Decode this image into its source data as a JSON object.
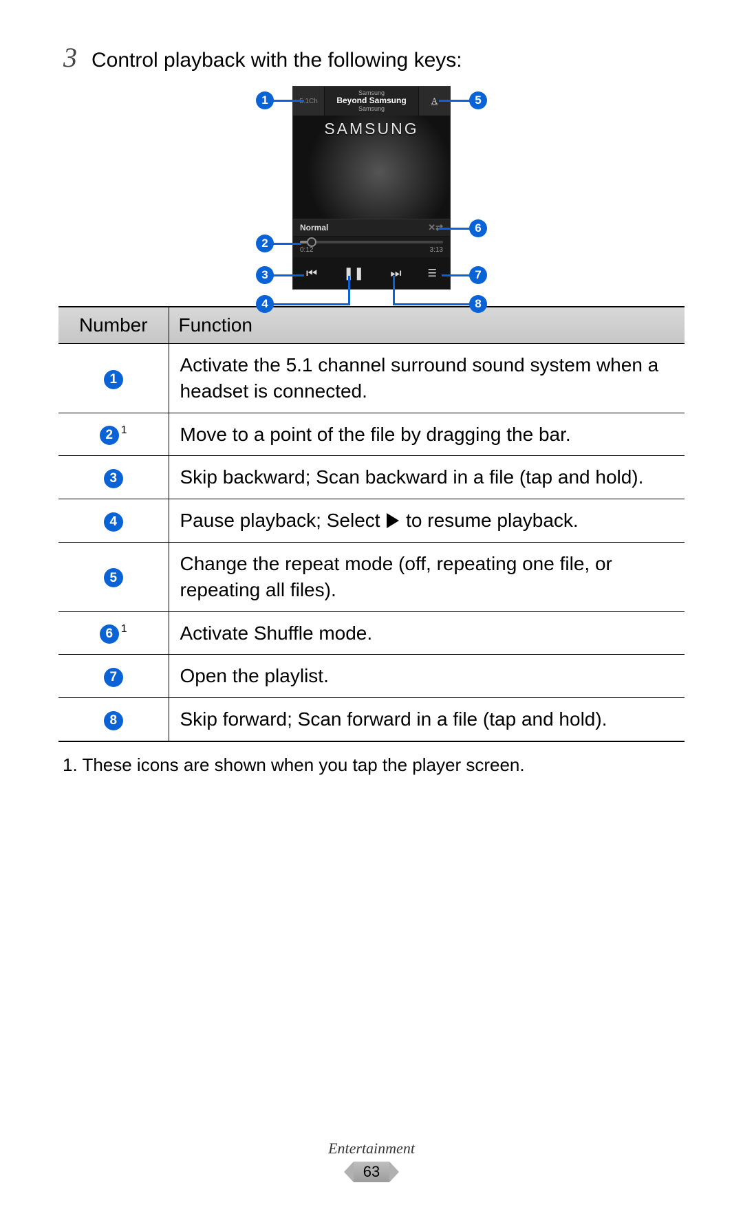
{
  "step": {
    "number": "3",
    "text": "Control playback with the following keys:"
  },
  "player": {
    "surround_label": "5.1Ch",
    "artist_top": "Samsung",
    "track_title": "Beyond Samsung",
    "artist_bottom": "Samsung",
    "album_logo": "SAMSUNG",
    "repeat_label": "A",
    "eq_label": "Normal",
    "time_elapsed": "0:12",
    "time_total": "3:13"
  },
  "callouts": {
    "c1": "1",
    "c2": "2",
    "c3": "3",
    "c4": "4",
    "c5": "5",
    "c6": "6",
    "c7": "7",
    "c8": "8"
  },
  "table": {
    "head_number": "Number",
    "head_function": "Function",
    "rows": [
      {
        "num": "1",
        "sup": "",
        "func": "Activate the 5.1 channel surround sound system when a headset is connected."
      },
      {
        "num": "2",
        "sup": "1",
        "func": "Move to a point of the file by dragging the bar."
      },
      {
        "num": "3",
        "sup": "",
        "func": "Skip backward; Scan backward in a file (tap and hold)."
      },
      {
        "num": "4",
        "sup": "",
        "func_pre": "Pause playback; Select ",
        "func_post": " to resume playback."
      },
      {
        "num": "5",
        "sup": "",
        "func": "Change the repeat mode (off, repeating one file, or repeating all files)."
      },
      {
        "num": "6",
        "sup": "1",
        "func": "Activate Shuffle mode."
      },
      {
        "num": "7",
        "sup": "",
        "func": "Open the playlist."
      },
      {
        "num": "8",
        "sup": "",
        "func": "Skip forward; Scan forward in a file (tap and hold)."
      }
    ]
  },
  "footnote": "1.  These icons are shown when you tap the player screen.",
  "footer": {
    "section": "Entertainment",
    "page": "63"
  }
}
